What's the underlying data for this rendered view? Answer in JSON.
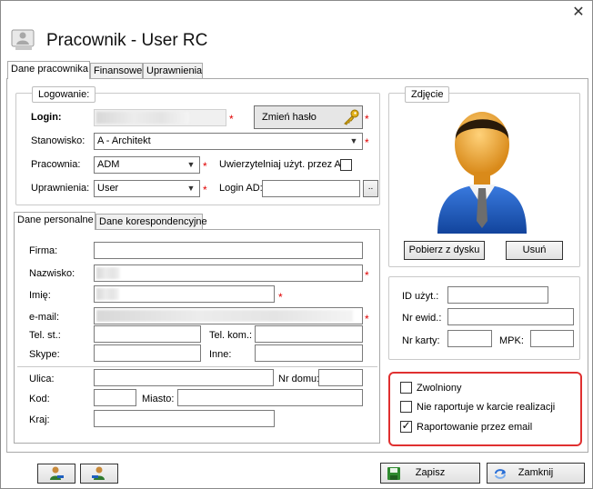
{
  "window": {
    "title": "Pracownik - User RC",
    "close_glyph": "✕"
  },
  "main_tabs": [
    {
      "label": "Dane pracownika",
      "active": true
    },
    {
      "label": "Finansowe",
      "active": false
    },
    {
      "label": "Uprawnienia",
      "active": false
    }
  ],
  "login_group": {
    "legend": "Logowanie:",
    "login_label": "Login:",
    "login_value": "",
    "change_password_label": "Zmień hasło",
    "position_label": "Stanowisko:",
    "position_value": "A - Architekt",
    "office_label": "Pracownia:",
    "office_value": "ADM",
    "ad_auth_label": "Uwierzytelniaj użyt. przez AD",
    "ad_auth_checked": false,
    "permissions_label": "Uprawnienia:",
    "permissions_value": "User",
    "login_ad_label": "Login AD:",
    "login_ad_value": "",
    "browse_label": "..",
    "required_mark": "*"
  },
  "photo_group": {
    "legend": "Zdjęcie",
    "load_button": "Pobierz z dysku",
    "remove_button": "Usuń"
  },
  "personal_tabs": [
    {
      "label": "Dane personalne",
      "active": true
    },
    {
      "label": "Dane korespondencyjne",
      "active": false
    }
  ],
  "personal": {
    "company_label": "Firma:",
    "surname_label": "Nazwisko:",
    "name_label": "Imię:",
    "email_label": "e-mail:",
    "phone_label": "Tel. st.:",
    "mobile_label": "Tel. kom.:",
    "skype_label": "Skype:",
    "other_label": "Inne:",
    "street_label": "Ulica:",
    "house_label": "Nr domu:",
    "zip_label": "Kod:",
    "city_label": "Miasto:",
    "country_label": "Kraj:"
  },
  "ids_group": {
    "user_id_label": "ID użyt.:",
    "record_label": "Nr ewid.:",
    "card_label": "Nr karty:",
    "mpk_label": "MPK:"
  },
  "flags": [
    {
      "label": "Zwolniony",
      "checked": false
    },
    {
      "label": "Nie raportuje w karcie realizacji",
      "checked": false
    },
    {
      "label": "Raportowanie przez email",
      "checked": true
    }
  ],
  "footer": {
    "save_button": "Zapisz",
    "close_button": "Zamknij"
  },
  "colors": {
    "required": "#e00000",
    "highlight_border": "#e03030"
  }
}
